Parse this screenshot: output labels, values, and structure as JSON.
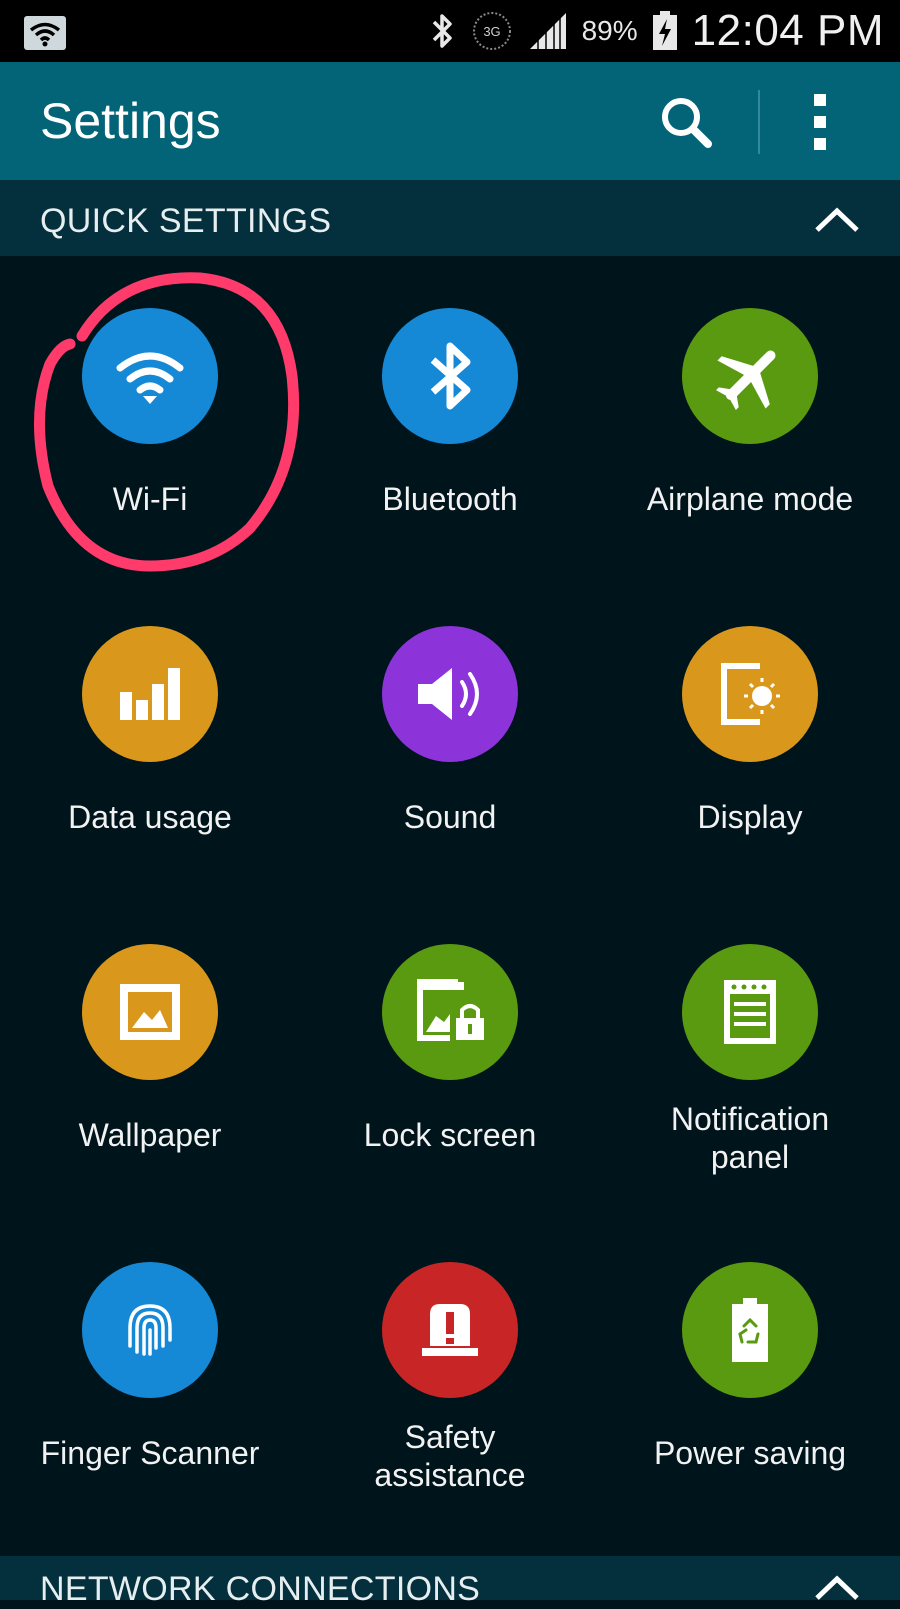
{
  "status_bar": {
    "battery_percent": "89%",
    "time": "12:04 PM",
    "network": "3G"
  },
  "header": {
    "title": "Settings"
  },
  "quick_settings": {
    "label": "QUICK SETTINGS",
    "items": [
      {
        "label": "Wi-Fi",
        "color": "#1589d6"
      },
      {
        "label": "Bluetooth",
        "color": "#1589d6"
      },
      {
        "label": "Airplane mode",
        "color": "#5a9a10"
      },
      {
        "label": "Data usage",
        "color": "#d9981b"
      },
      {
        "label": "Sound",
        "color": "#8c34da"
      },
      {
        "label": "Display",
        "color": "#d9981b"
      },
      {
        "label": "Wallpaper",
        "color": "#d9981b"
      },
      {
        "label": "Lock screen",
        "color": "#5a9a10"
      },
      {
        "label": "Notification panel",
        "color": "#5a9a10"
      },
      {
        "label": "Finger Scanner",
        "color": "#1589d6"
      },
      {
        "label": "Safety assistance",
        "color": "#c82626"
      },
      {
        "label": "Power saving",
        "color": "#5a9a10"
      }
    ]
  },
  "network_connections": {
    "label": "NETWORK CONNECTIONS"
  },
  "annotation": {
    "color": "#ff3b6b",
    "target": "Wi-Fi"
  }
}
